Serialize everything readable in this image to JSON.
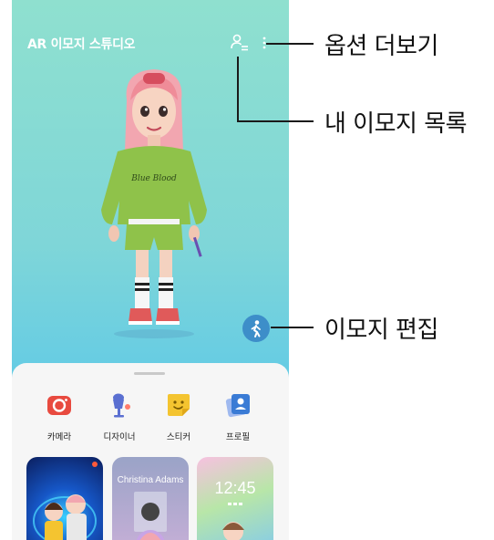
{
  "app": {
    "title": "AR 이모지 스튜디오"
  },
  "header_icons": [
    "my-emoji-list-icon",
    "more-options-icon"
  ],
  "tools": [
    {
      "label": "카메라",
      "icon": "camera-icon",
      "color": "#e84a3f"
    },
    {
      "label": "디자이너",
      "icon": "designer-icon",
      "color": "#5a6fd1"
    },
    {
      "label": "스티커",
      "icon": "sticker-icon",
      "color": "#f4c430"
    },
    {
      "label": "프로필",
      "icon": "profile-icon",
      "color": "#3a7bd5"
    }
  ],
  "cards": [
    {
      "name": "camera-preview"
    },
    {
      "name": "profile-preview",
      "text": "Christina Adams"
    },
    {
      "name": "lockscreen-preview",
      "time": "12:45"
    }
  ],
  "callouts": {
    "more_options": "옵션 더보기",
    "my_emoji_list": "내 이모지 목록",
    "edit_emoji": "이모지 편집"
  }
}
